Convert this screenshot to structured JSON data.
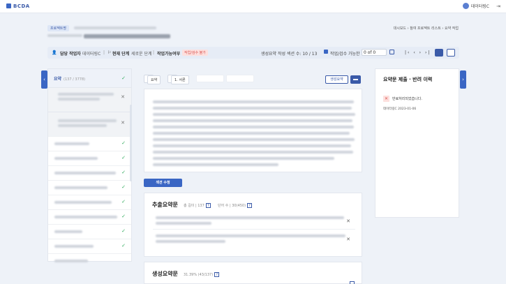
{
  "header": {
    "logo": "BCDA",
    "user_name": "데이터링C",
    "logout_icon": "logout-icon"
  },
  "page": {
    "category_tag": "프로젝트명",
    "breadcrumb": [
      "대시보드",
      "참여 프로젝트 리스트",
      "요약 작업"
    ]
  },
  "infobar": {
    "assignee_label": "담당 작업자",
    "assignee_value": "데이터링C",
    "stage_label": "현재 단계",
    "stage_value": "세로운 단계",
    "workable_label": "작업가능여부",
    "workable_badge": "작업/검수 불가",
    "summary_progress": "생성요약 작성 섹션 수: 10 / 13",
    "review_check_label": "작업/검수 가능한",
    "page_value": "0 of 0"
  },
  "left_panel": {
    "header_label": "요약",
    "header_count": "(137 / 3778)",
    "rows": [
      {
        "status": "check"
      },
      {
        "status": "check"
      },
      {
        "status": "check"
      },
      {
        "status": "check"
      },
      {
        "status": "check"
      },
      {
        "status": "check"
      },
      {
        "status": "check"
      },
      {
        "status": "check"
      },
      {
        "status": "check"
      }
    ]
  },
  "middle": {
    "tabs": [
      {
        "label": "요약"
      },
      {
        "label": "1. 서론"
      }
    ],
    "generate_button": "생성요약",
    "edit_button": "섹션 수정",
    "extract_section": {
      "title": "추출요약문",
      "meta1": "총 길이 | 137",
      "meta2": "단어 수 | 30(450)",
      "help": "?"
    },
    "gen_section": {
      "title": "생성요약문",
      "meta1": "31.39% (43/137)",
      "help": "?"
    }
  },
  "right_panel": {
    "title": "요약문 제출 · 반려 이력",
    "entry_message": "반료처리되었습니다.",
    "entry_meta": "데이터링C 2023-01-06"
  },
  "colors": {
    "accent": "#3a66c4",
    "check_green": "#2eaa5a",
    "reject_red": "#d9534f"
  }
}
